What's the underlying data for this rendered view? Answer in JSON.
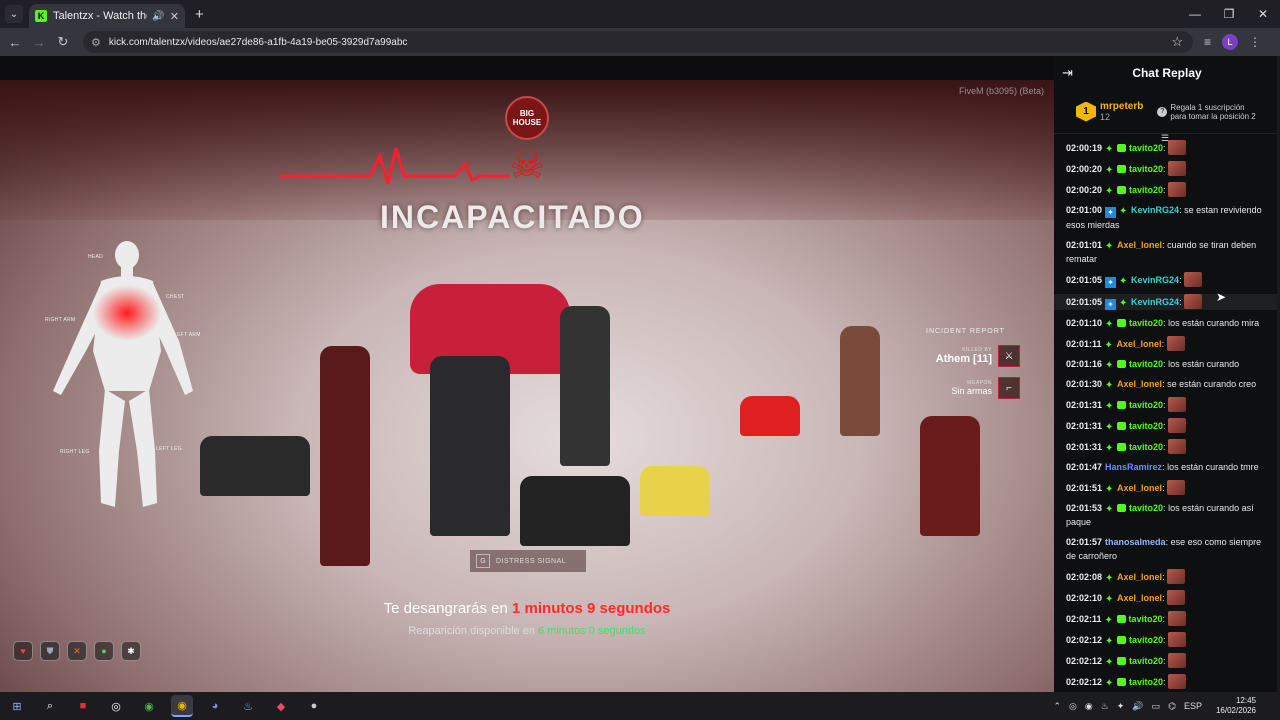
{
  "browser": {
    "tab_title": "Talentzx - Watch the VOD o",
    "url": "kick.com/talentzx/videos/ae27de86-a1fb-4a19-be05-3929d7a99abc",
    "profile_initial": "L"
  },
  "video": {
    "watermark": "FiveM (b3095) (Beta)",
    "logo_text": "BIG HOUSE",
    "incap_title": "INCAPACITADO",
    "body_labels": {
      "head": "HEAD",
      "chest": "CHEST",
      "right_arm": "RIGHT ARM",
      "left_arm": "LEFT ARM",
      "right_leg": "RIGHT LEG",
      "left_leg": "LEFT LEG"
    },
    "incident": {
      "title": "INCIDENT REPORT",
      "killed_by_label": "KILLED BY",
      "killed_by": "Athem [11]",
      "weapon_label": "WEAPON",
      "weapon": "Sin armas"
    },
    "distress": {
      "key": "G",
      "label": "DISTRESS SIGNAL"
    },
    "bleed": {
      "prefix": "Te desangrarás en ",
      "time": "1 minutos 9 segundos"
    },
    "respawn": {
      "prefix": "Reaparición disponible en ",
      "time": "6 minutos 0 segundos"
    }
  },
  "chat": {
    "title": "Chat Replay",
    "pinned": {
      "rank": "1",
      "user": "mrpeterb",
      "count": "12",
      "gift_text": "Regala 1 suscripción para tomar la posición 2"
    },
    "messages": [
      {
        "time": "02:00:19",
        "user": "tavito20",
        "text": "",
        "emote": true,
        "color": "#53fc18",
        "badges": "sp-sub"
      },
      {
        "time": "02:00:20",
        "user": "tavito20",
        "text": "",
        "emote": true,
        "color": "#53fc18",
        "badges": "sp-sub"
      },
      {
        "time": "02:00:20",
        "user": "tavito20",
        "text": "",
        "emote": true,
        "color": "#53fc18",
        "badges": "sp-sub"
      },
      {
        "time": "02:01:00",
        "user": "KevinRG24",
        "text": " se estan reviviendo esos mierdas",
        "emote": false,
        "color": "#3fd0d8",
        "badges": "gift-sp"
      },
      {
        "time": "02:01:01",
        "user": "Axel_lonel",
        "text": " cuando se tiran deben rematar",
        "emote": false,
        "color": "#f2a21b",
        "badges": "sp"
      },
      {
        "time": "02:01:05",
        "user": "KevinRG24",
        "text": "",
        "emote": true,
        "color": "#3fd0d8",
        "badges": "gift-sp"
      },
      {
        "time": "02:01:05",
        "user": "KevinRG24",
        "text": "",
        "emote": true,
        "color": "#3fd0d8",
        "badges": "gift-sp",
        "highlight": true
      },
      {
        "time": "02:01:10",
        "user": "tavito20",
        "text": " los están curando mira",
        "emote": false,
        "color": "#53fc18",
        "badges": "sp-sub"
      },
      {
        "time": "02:01:11",
        "user": "Axel_lonel",
        "text": "",
        "emote": true,
        "color": "#f2a21b",
        "badges": "sp"
      },
      {
        "time": "02:01:16",
        "user": "tavito20",
        "text": " los están curando",
        "emote": false,
        "color": "#53fc18",
        "badges": "sp-sub"
      },
      {
        "time": "02:01:30",
        "user": "Axel_lonel",
        "text": " se están curando creo",
        "emote": false,
        "color": "#f2a21b",
        "badges": "sp"
      },
      {
        "time": "02:01:31",
        "user": "tavito20",
        "text": "",
        "emote": true,
        "color": "#53fc18",
        "badges": "sp-sub"
      },
      {
        "time": "02:01:31",
        "user": "tavito20",
        "text": "",
        "emote": true,
        "color": "#53fc18",
        "badges": "sp-sub"
      },
      {
        "time": "02:01:31",
        "user": "tavito20",
        "text": "",
        "emote": true,
        "color": "#53fc18",
        "badges": "sp-sub"
      },
      {
        "time": "02:01:47",
        "user": "HansRamirez",
        "text": " los están curando tmre",
        "emote": false,
        "color": "#6f8cff",
        "badges": ""
      },
      {
        "time": "02:01:51",
        "user": "Axel_lonel",
        "text": "",
        "emote": true,
        "color": "#f2a21b",
        "badges": "sp"
      },
      {
        "time": "02:01:53",
        "user": "tavito20",
        "text": " los están curando así paque",
        "emote": false,
        "color": "#53fc18",
        "badges": "sp-sub"
      },
      {
        "time": "02:01:57",
        "user": "thanosalmeda",
        "text": " ese eso como siempre de carroñero",
        "emote": false,
        "color": "#8fb6ff",
        "badges": ""
      },
      {
        "time": "02:02:08",
        "user": "Axel_lonel",
        "text": "",
        "emote": true,
        "color": "#f2a21b",
        "badges": "sp"
      },
      {
        "time": "02:02:10",
        "user": "Axel_lonel",
        "text": "",
        "emote": true,
        "color": "#f2a21b",
        "badges": "sp"
      },
      {
        "time": "02:02:11",
        "user": "tavito20",
        "text": "",
        "emote": true,
        "color": "#53fc18",
        "badges": "sp-sub"
      },
      {
        "time": "02:02:12",
        "user": "tavito20",
        "text": "",
        "emote": true,
        "color": "#53fc18",
        "badges": "sp-sub"
      },
      {
        "time": "02:02:12",
        "user": "tavito20",
        "text": "",
        "emote": true,
        "color": "#53fc18",
        "badges": "sp-sub"
      },
      {
        "time": "02:02:12",
        "user": "tavito20",
        "text": "",
        "emote": true,
        "color": "#53fc18",
        "badges": "sp-sub"
      }
    ]
  },
  "taskbar": {
    "lang": "ESP",
    "time": "12:45",
    "date": "16/02/2026"
  }
}
